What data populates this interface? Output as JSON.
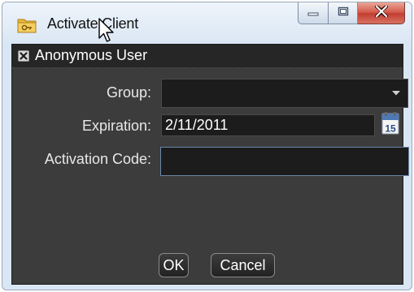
{
  "window": {
    "title": "Activate Client",
    "icons": {
      "app": "folder-key-icon",
      "minimize": "minimize-icon",
      "maximize": "maximize-icon",
      "close": "close-icon",
      "cursor": "mouse-pointer-icon"
    }
  },
  "section": {
    "header_label": "Anonymous User",
    "collapse_icon": "collapse-x-icon"
  },
  "form": {
    "group_label": "Group:",
    "group_value": "",
    "expiration_label": "Expiration:",
    "expiration_value": "2/11/2011",
    "calendar_icon_day": "15",
    "activation_code_label": "Activation Code:",
    "activation_code_value": ""
  },
  "buttons": {
    "ok_label": "OK",
    "cancel_label": "Cancel"
  },
  "colors": {
    "content_bg": "#3c3c3c",
    "header_strip_bg": "#262626",
    "close_button": "#c9473a",
    "titlebar_bg": "#dbe7f4",
    "focus_border": "#6a86a8"
  }
}
